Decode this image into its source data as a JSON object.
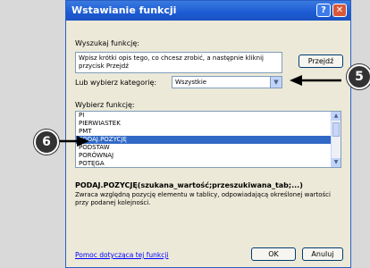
{
  "dialog": {
    "title": "Wstawianie funkcji",
    "help_btn": "?",
    "close_btn": "✕",
    "search_label": "Wyszukaj funkcję:",
    "search_text": "Wpisz krótki opis tego, co chcesz zrobić, a następnie kliknij przycisk Przejdź",
    "go_label": "Przejdź",
    "category_label": "Lub wybierz kategorię:",
    "category_value": "Wszystkie",
    "select_fn_label": "Wybierz funkcję:",
    "functions": [
      {
        "name": "PI",
        "selected": false
      },
      {
        "name": "PIERWIASTEK",
        "selected": false
      },
      {
        "name": "PMT",
        "selected": false
      },
      {
        "name": "PODAJ.POZYCJĘ",
        "selected": true
      },
      {
        "name": "PODSTAW",
        "selected": false
      },
      {
        "name": "PORÓWNAJ",
        "selected": false
      },
      {
        "name": "POTĘGA",
        "selected": false
      }
    ],
    "signature": "PODAJ.POZYCJĘ(szukana_wartość;przeszukiwana_tab;...)",
    "description": "Zwraca względną pozycję elementu w tablicy, odpowiadającą określonej wartości przy podanej kolejności.",
    "help_link": "Pomoc dotycząca tej funkcji",
    "ok_label": "OK",
    "cancel_label": "Anuluj"
  },
  "callouts": {
    "five": "5",
    "six": "6"
  },
  "colors": {
    "selection": "#3169c6",
    "titlebar": "#1c5bd3",
    "callout": "#333333"
  }
}
